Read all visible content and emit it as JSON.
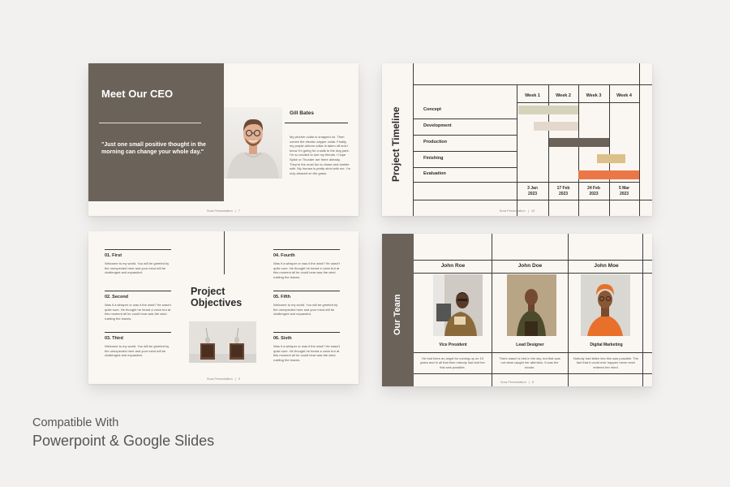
{
  "slide_ceo": {
    "title": "Meet Our CEO",
    "quote": "\"Just one small positive thought in the morning can change your whole day.\"",
    "name": "Gill Bates",
    "bio": "My pincher collar is snapped on. Then comes the electric zapper collar. Finally, my purple airhorn collar is taken off and I know I'm going for a walk to the dog park. I'm so excited to see my friends. I hope Spike or Thunder are there already. They're the most fun to chase and tumble with. My human is pretty strict with me. I'm only allowed on the grass.",
    "footer_brand": "Sora",
    "footer_label": "Presentation",
    "footer_sep": "|",
    "page": "7"
  },
  "slide_timeline": {
    "title": "Project Timeline",
    "weeks": [
      "Week 1",
      "Week 2",
      "Week 3",
      "Week 4"
    ],
    "tasks": [
      "Concept",
      "Development",
      "Production",
      "Finishing",
      "Evaluation"
    ],
    "dates": [
      "3 Jan\n2023",
      "17 Feb\n2023",
      "24 Feb\n2023",
      "5 Mar\n2023"
    ],
    "bar_colors": [
      "#d6d3bd",
      "#e4d8cd",
      "#6b6259",
      "#dcc08a",
      "#ec7746"
    ],
    "footer_brand": "Sora",
    "footer_label": "Presentation",
    "footer_sep": "|",
    "page": "10"
  },
  "slide_objectives": {
    "title": "Project\nObjectives",
    "items": [
      {
        "title": "01. First",
        "desc": "Welcome to my world. You will be greeted by the unexpected here and your mind will be challenged and expanded."
      },
      {
        "title": "02. Second",
        "desc": "Was it a whisper or was it the wind? He wasn't quite sure. He thought he heard a voice but at this moment all he could hear was the wind rustling the leaves."
      },
      {
        "title": "03. Third",
        "desc": "Welcome to my world. You will be greeted by the unexpected here and your mind will be challenged and expanded."
      },
      {
        "title": "04. Fourth",
        "desc": "Was it a whisper or was it the wind? He wasn't quite sure. He thought he heard a voice but at this moment all he could hear was the wind rustling the leaves."
      },
      {
        "title": "05. Fifth",
        "desc": "Welcome to my world. You will be greeted by the unexpected here and your mind will be challenged and expanded."
      },
      {
        "title": "06. Sixth",
        "desc": "Was it a whisper or was it the wind? He wasn't quite sure. He thought he heard a voice but at this moment all he could hear was the wind rustling the leaves."
      }
    ],
    "footer_brand": "Sora",
    "footer_label": "Presentation",
    "footer_sep": "|",
    "page": "9"
  },
  "slide_team": {
    "title": "Our Team",
    "members": [
      {
        "name": "John Roe",
        "role": "Vice President",
        "desc": "He had been an angel for coming up on 10 years and in all that time nobody had told her this was possible."
      },
      {
        "name": "John Doe",
        "role": "Lead Designer",
        "desc": "There wasn't a bird in the sky, but that was not what caught her attention. It was the clouds."
      },
      {
        "name": "John Moe",
        "role": "Digital Marketing",
        "desc": "Nobody had fallen into this was possible. The fact that it could ever happen never even entered her mind."
      }
    ],
    "footer_brand": "Sora",
    "footer_label": "Presentation",
    "footer_sep": "|",
    "page": "8"
  },
  "caption": {
    "line1": "Compatible With",
    "line2": "Powerpoint & Google Slides"
  }
}
